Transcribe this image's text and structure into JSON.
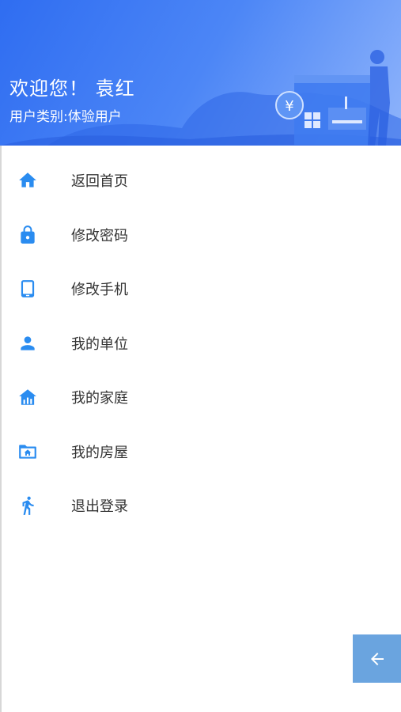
{
  "colors": {
    "accent": "#2a8cf0",
    "header_start": "#2f6df1",
    "header_end": "#8fb4fb",
    "back_button": "#6aa4df"
  },
  "header": {
    "greeting": "欢迎您！ 袁红",
    "user_type": "用户类别:体验用户",
    "illustration": "building-with-yen-coin-and-person"
  },
  "menu": {
    "items": [
      {
        "label": "返回首页",
        "icon": "home-icon"
      },
      {
        "label": "修改密码",
        "icon": "lock-icon"
      },
      {
        "label": "修改手机",
        "icon": "tablet-icon"
      },
      {
        "label": "我的单位",
        "icon": "person-icon"
      },
      {
        "label": "我的家庭",
        "icon": "house-chart-icon"
      },
      {
        "label": "我的房屋",
        "icon": "folder-home-icon"
      },
      {
        "label": "退出登录",
        "icon": "exit-runner-icon"
      }
    ]
  },
  "back_button": {
    "icon": "arrow-left-icon"
  }
}
